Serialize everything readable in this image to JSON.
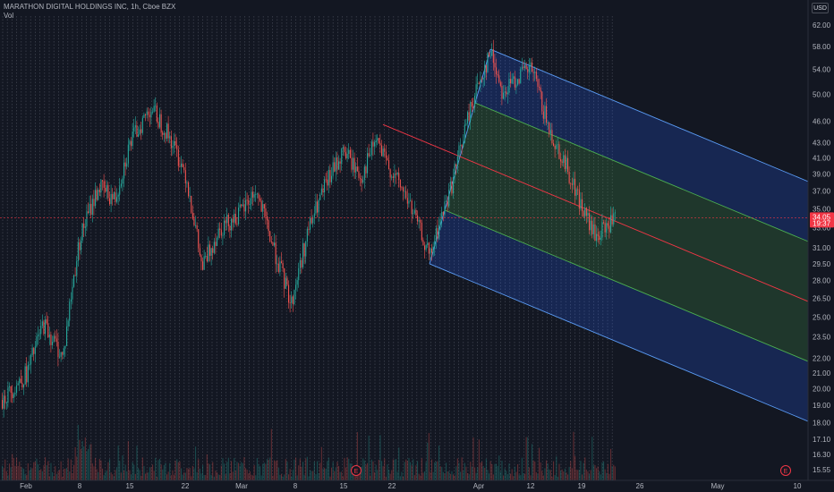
{
  "legend": {
    "symbol": "MARATHON DIGITAL HOLDINGS INC, 1h, Cboe BZX",
    "volume_label": "Vol"
  },
  "price_axis": {
    "currency": "USD",
    "ticks": [
      "62.00",
      "58.00",
      "54.00",
      "50.00",
      "46.00",
      "43.00",
      "41.00",
      "39.00",
      "37.00",
      "35.00",
      "33.00",
      "31.00",
      "29.50",
      "28.00",
      "26.50",
      "25.00",
      "23.50",
      "22.00",
      "21.00",
      "20.00",
      "19.00",
      "18.00",
      "17.10",
      "16.30",
      "15.55"
    ],
    "last_price": "34.05",
    "countdown": "19:37"
  },
  "time_axis": {
    "labels": [
      "Feb",
      "8",
      "15",
      "22",
      "Mar",
      "8",
      "15",
      "22",
      "Apr",
      "12",
      "19",
      "26",
      "May",
      "10"
    ]
  },
  "earnings_markers": [
    "E",
    "E"
  ],
  "colors": {
    "background": "#131722",
    "up": "#26a69a",
    "down": "#ef5350",
    "channel_blue": "#2962ff",
    "channel_green": "#4caf50",
    "median_line": "#f23645",
    "price_line": "#f23645"
  },
  "chart_data": {
    "type": "candlestick",
    "title": "MARATHON DIGITAL HOLDINGS INC, 1h, Cboe BZX",
    "interval": "1h",
    "y_scale": "log",
    "ylim": [
      15.2,
      64
    ],
    "x_labels": [
      "Feb",
      "8",
      "15",
      "22",
      "Mar",
      "8",
      "15",
      "22",
      "Apr",
      "12",
      "19",
      "26",
      "May",
      "10"
    ],
    "last_price": 34.05,
    "price_path": [
      {
        "date": "Jan 28",
        "close": 19.5
      },
      {
        "date": "Feb 1",
        "close": 21.0
      },
      {
        "date": "Feb 3",
        "close": 24.5
      },
      {
        "date": "Feb 5",
        "close": 22.0
      },
      {
        "date": "Feb 8",
        "close": 32.0
      },
      {
        "date": "Feb 10",
        "close": 37.5
      },
      {
        "date": "Feb 12",
        "close": 36.0
      },
      {
        "date": "Feb 15",
        "close": 43.0
      },
      {
        "date": "Feb 17",
        "close": 48.0
      },
      {
        "date": "Feb 19",
        "close": 44.0
      },
      {
        "date": "Feb 22",
        "close": 39.0
      },
      {
        "date": "Feb 24",
        "close": 29.0
      },
      {
        "date": "Feb 26",
        "close": 33.0
      },
      {
        "date": "Mar 1",
        "close": 34.5
      },
      {
        "date": "Mar 3",
        "close": 37.0
      },
      {
        "date": "Mar 5",
        "close": 31.0
      },
      {
        "date": "Mar 8",
        "close": 26.0
      },
      {
        "date": "Mar 10",
        "close": 33.0
      },
      {
        "date": "Mar 12",
        "close": 38.0
      },
      {
        "date": "Mar 15",
        "close": 42.0
      },
      {
        "date": "Mar 17",
        "close": 38.5
      },
      {
        "date": "Mar 19",
        "close": 43.5
      },
      {
        "date": "Mar 22",
        "close": 41.0
      },
      {
        "date": "Mar 24",
        "close": 36.0
      },
      {
        "date": "Mar 26",
        "close": 30.0
      },
      {
        "date": "Mar 29",
        "close": 38.0
      },
      {
        "date": "Apr 1",
        "close": 50.0
      },
      {
        "date": "Apr 5",
        "close": 57.0
      },
      {
        "date": "Apr 7",
        "close": 50.0
      },
      {
        "date": "Apr 9",
        "close": 53.0
      },
      {
        "date": "Apr 12",
        "close": 54.0
      },
      {
        "date": "Apr 14",
        "close": 45.0
      },
      {
        "date": "Apr 16",
        "close": 40.0
      },
      {
        "date": "Apr 19",
        "close": 35.0
      },
      {
        "date": "Apr 20",
        "close": 32.0
      },
      {
        "date": "Apr 22",
        "close": 34.05
      }
    ],
    "pitchfork": {
      "type": "pitchfork",
      "points": [
        {
          "date": "Mar 22",
          "price": 45.5
        },
        {
          "date": "Mar 26",
          "price": 29.5
        },
        {
          "date": "Apr 5",
          "price": 57.5
        }
      ],
      "levels": [
        "outer",
        "inner",
        "median",
        "inner",
        "outer"
      ]
    }
  }
}
